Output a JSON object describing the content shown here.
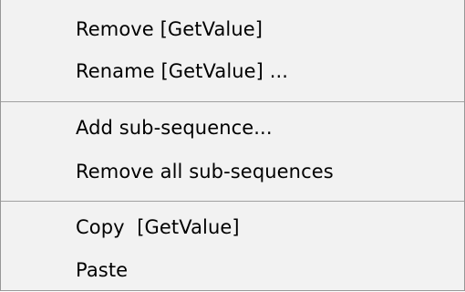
{
  "context_menu": {
    "group1": {
      "remove": "Remove [GetValue]",
      "rename": "Rename [GetValue] ..."
    },
    "group2": {
      "add_sub_sequence": "Add sub-sequence...",
      "remove_all_sub_sequences": "Remove all sub-sequences"
    },
    "group3": {
      "copy": "Copy  [GetValue]",
      "paste": "Paste"
    }
  },
  "colors": {
    "menu_background": "#f2f2f2",
    "separator": "#a0a0a0",
    "border": "#979797",
    "text": "#000000"
  }
}
